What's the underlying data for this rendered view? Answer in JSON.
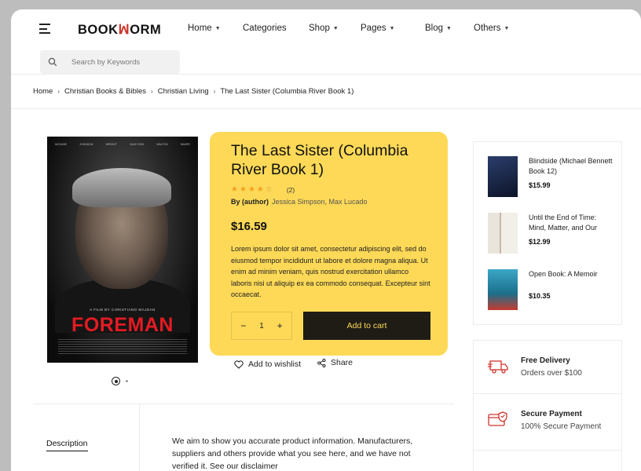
{
  "header": {
    "logo_left": "BOOK",
    "logo_right": "ORM",
    "nav": [
      {
        "label": "Home",
        "dropdown": true
      },
      {
        "label": "Categories",
        "dropdown": false
      },
      {
        "label": "Shop",
        "dropdown": true
      },
      {
        "label": "Pages",
        "dropdown": true
      },
      {
        "label": "Blog",
        "dropdown": true
      },
      {
        "label": "Others",
        "dropdown": true
      }
    ],
    "search_placeholder": "Search by Keywords"
  },
  "breadcrumb": [
    "Home",
    "Christian Books & Bibles",
    "Christian Living",
    "The Last Sister (Columbia River Book 1)"
  ],
  "gallery": {
    "poster_credits": [
      "MCKANE",
      "JOHNSON",
      "WRIGHT",
      "DALE DON",
      "WALTON",
      "BAKER"
    ],
    "poster_tagline": "A FILM BY CHRISTIANO MAJDAN",
    "poster_title": "FOREMAN"
  },
  "product": {
    "title": "The Last Sister (Columbia River Book 1)",
    "rating": 4,
    "rating_count": "(2)",
    "author_label": "By (author)",
    "authors": "Jessica Simpson, Max Lucado",
    "price": "$16.59",
    "description": "Lorem ipsum dolor sit amet, consectetur adipiscing elit, sed do eiusmod tempor incididunt ut labore et dolore magna aliqua. Ut enim ad minim veniam, quis nostrud exercitation ullamco laboris nisi ut aliquip ex ea commodo consequat. Excepteur sint occaecat.",
    "quantity": "1",
    "add_to_cart": "Add to cart",
    "wishlist": "Add to wishlist",
    "share": "Share"
  },
  "related": [
    {
      "title": "Blindside (Michael Bennett Book 12)",
      "price": "$15.99",
      "cover_color": "#1b2a4a"
    },
    {
      "title": "Until the End of Time: Mind, Matter, and Our",
      "price": "$12.99",
      "cover_color": "#e8e4dc"
    },
    {
      "title": "Open Book: A Memoir",
      "price": "$10.35",
      "cover_color": "#2b8fb0"
    }
  ],
  "features": [
    {
      "title": "Free Delivery",
      "subtitle": "Orders over $100",
      "icon": "truck-icon"
    },
    {
      "title": "Secure Payment",
      "subtitle": "100% Secure Payment",
      "icon": "secure-card-icon"
    }
  ],
  "tabs": {
    "description_label": "Description",
    "text": "We aim to show you accurate product information. Manufacturers, suppliers and others provide what you see here, and we have not verified it. See our disclaimer"
  },
  "colors": {
    "accent_yellow": "#fdd957",
    "brand_red": "#d0342c",
    "dark": "#1f1c16"
  }
}
